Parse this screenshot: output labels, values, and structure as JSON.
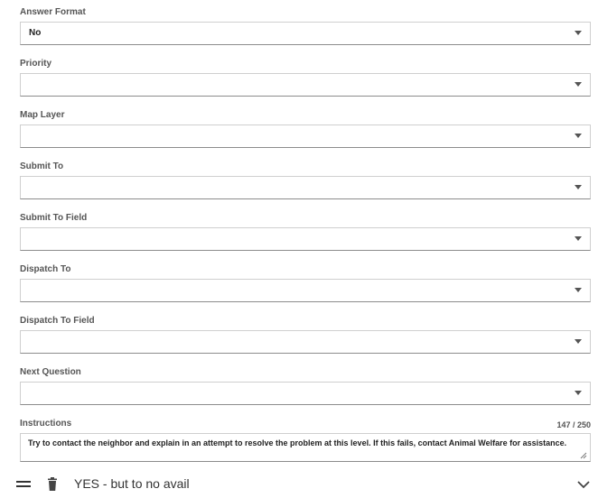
{
  "form": {
    "answer_format": {
      "label": "Answer Format",
      "value": "No"
    },
    "priority": {
      "label": "Priority",
      "value": ""
    },
    "map_layer": {
      "label": "Map Layer",
      "value": ""
    },
    "submit_to": {
      "label": "Submit To",
      "value": ""
    },
    "submit_to_field": {
      "label": "Submit To Field",
      "value": ""
    },
    "dispatch_to": {
      "label": "Dispatch To",
      "value": ""
    },
    "dispatch_to_field": {
      "label": "Dispatch To Field",
      "value": ""
    },
    "next_question": {
      "label": "Next Question",
      "value": ""
    },
    "instructions": {
      "label": "Instructions",
      "counter": "147 / 250",
      "value": "Try to contact the neighbor and explain in an attempt to resolve the problem at this level. If this fails, contact Animal Welfare for assistance."
    }
  },
  "answer_row": {
    "title": "YES - but to no avail",
    "icons": [
      "drag-handle-icon",
      "trash-icon",
      "chevron-down-icon"
    ]
  },
  "colors": {
    "label": "#555555",
    "border": "#cfcfcf",
    "underline": "#8c8c8c",
    "text": "#222222"
  }
}
